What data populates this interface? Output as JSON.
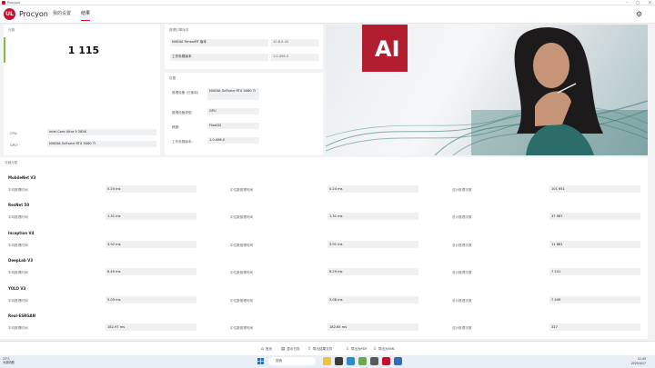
{
  "window": {
    "title": "Procyon",
    "minimize": "–",
    "maximize": "□",
    "close": "✕"
  },
  "header": {
    "app_name": "Procyon",
    "logo_text": "UL",
    "nav": [
      "我的设置",
      "结果"
    ]
  },
  "score_section": {
    "title": "分数",
    "score": "1 115",
    "cpu_label": "CPU:",
    "cpu_value": "Intel Core Ultra 9 285K",
    "gpu_label": "GPU:",
    "gpu_value": "NVIDIA GeForce RTX 5060 Ti"
  },
  "engine_section": {
    "title": "推理引擎版本",
    "rows": [
      {
        "label": "NVIDIA TensorRT 版本",
        "value": "10.8.0.43"
      },
      {
        "label": "工作负载版本",
        "value": "1.0.496.0"
      }
    ]
  },
  "settings_section": {
    "title": "设置",
    "rows": [
      {
        "label": "推理设备 (已使用)",
        "value": "NVIDIA GeForce RTX 5060 Ti"
      },
      {
        "label": "推理设备类型:",
        "value": "GPU"
      },
      {
        "label": "精度:",
        "value": "Float32"
      },
      {
        "label": "工作负载版本:",
        "value": "1.0.496.0"
      }
    ]
  },
  "hero": {
    "logo_text": "AI"
  },
  "details": {
    "title": "详细分数",
    "col_labels": [
      "平均推理时间",
      "中位数推理时间",
      "总计推理次数"
    ],
    "rows": [
      {
        "name": "MobileNet V3",
        "avg": "0.25 ms",
        "median": "0.24 ms",
        "count": "101 651"
      },
      {
        "name": "ResNet 50",
        "avg": "1.31 ms",
        "median": "1.31 ms",
        "count": "37 987"
      },
      {
        "name": "Inception V4",
        "avg": "3.92 ms",
        "median": "3.91 ms",
        "count": "11 881"
      },
      {
        "name": "DeepLab V3",
        "avg": "6.49 ms",
        "median": "6.29 ms",
        "count": "7 231"
      },
      {
        "name": "YOLO V3",
        "avg": "5.09 ms",
        "median": "5.08 ms",
        "count": "7 449"
      },
      {
        "name": "Real-ESRGAN",
        "avg": "182.97 ms",
        "median": "182.65 ms",
        "count": "327"
      }
    ]
  },
  "footer_actions": [
    {
      "icon": "home-icon",
      "glyph": "⌂",
      "label": "首页"
    },
    {
      "icon": "log-icon",
      "glyph": "▤",
      "label": "显示日志"
    },
    {
      "icon": "export-icon",
      "glyph": "⇪",
      "label": "导出结果文件"
    },
    {
      "icon": "pdf-icon",
      "glyph": "⇩",
      "label": "导出为PDF"
    },
    {
      "icon": "xml-icon",
      "glyph": "⇩",
      "label": "导出为XML"
    }
  ],
  "taskbar": {
    "weather_temp": "23°C",
    "weather_desc": "大部晴朗",
    "search_placeholder": "搜索",
    "time": "11:43",
    "date": "2025/4/17"
  },
  "colors": {
    "brand": "#c8102e",
    "score_bar": "#7cc242",
    "ai_logo": "#b21e2f"
  }
}
